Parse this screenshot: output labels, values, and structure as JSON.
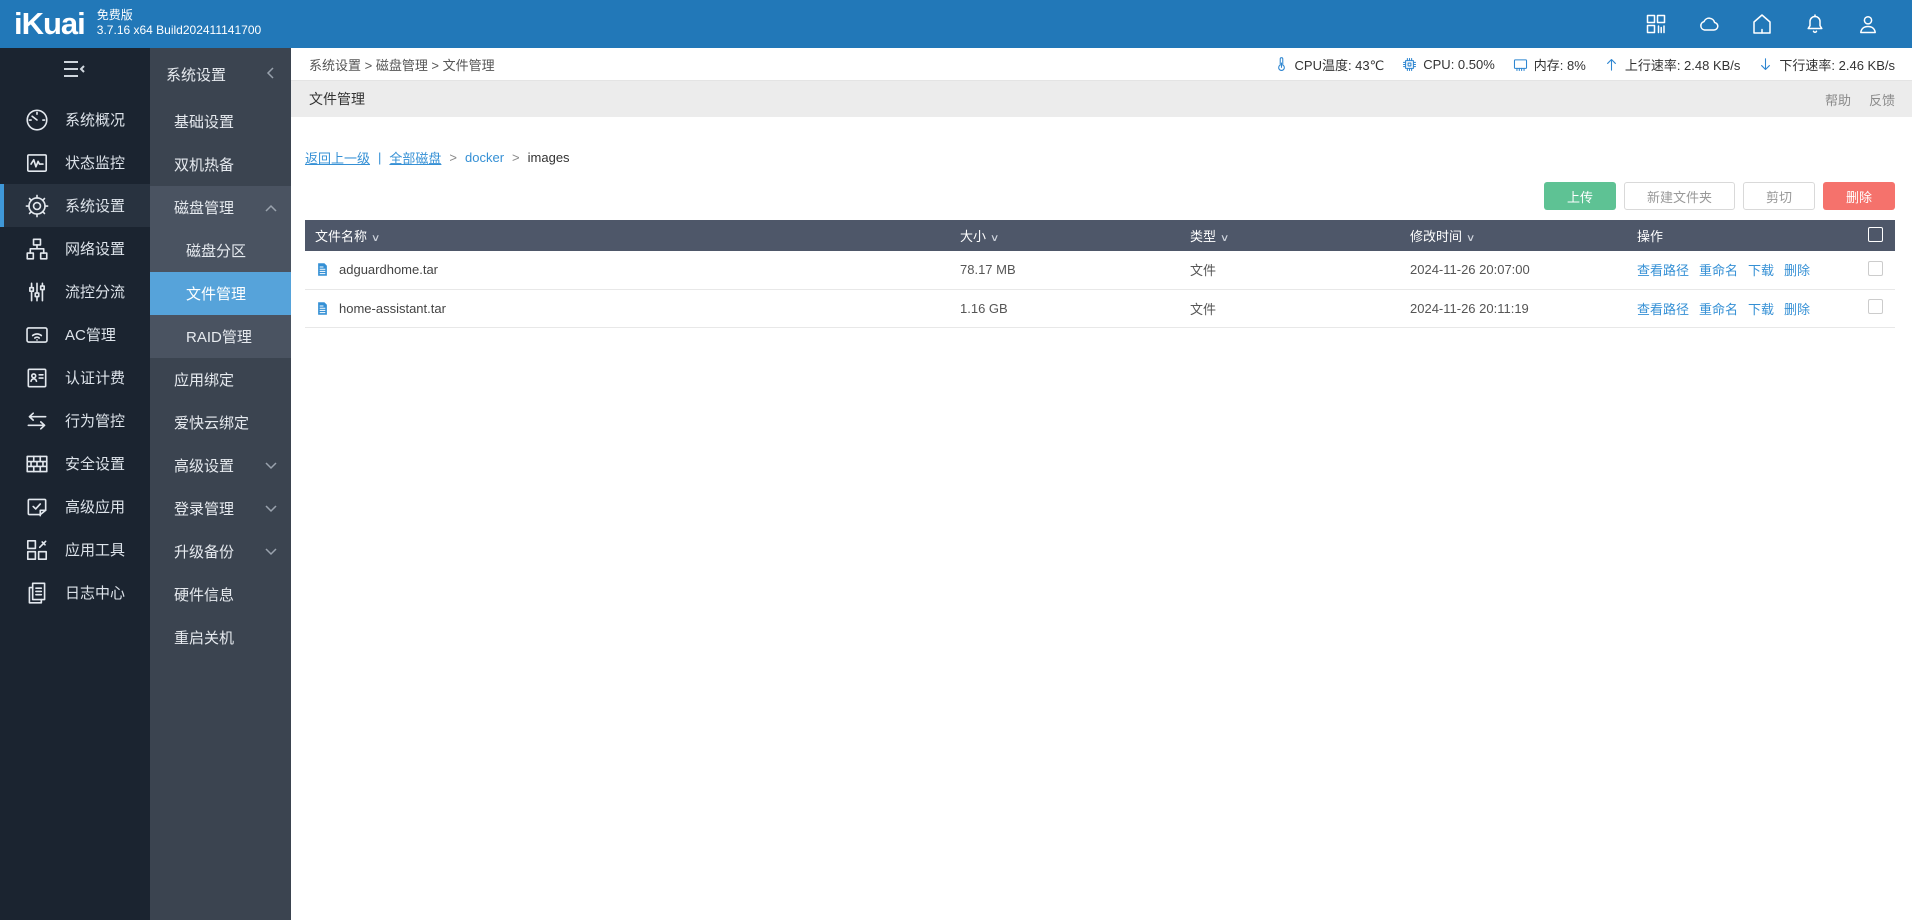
{
  "topbar": {
    "logo": "iKuai",
    "edition": "免费版",
    "build": "3.7.16 x64 Build202411141700",
    "icons": [
      {
        "key": "apps",
        "icon": "apps-grid-icon"
      },
      {
        "key": "cloud",
        "icon": "cloud-icon"
      },
      {
        "key": "home",
        "icon": "home-icon"
      },
      {
        "key": "notifications",
        "icon": "bell-icon"
      },
      {
        "key": "account",
        "icon": "user-icon"
      }
    ]
  },
  "sidebar": {
    "items": [
      {
        "key": "system-overview",
        "label": "系统概况",
        "icon": "gauge-icon",
        "active": false
      },
      {
        "key": "status-monitor",
        "label": "状态监控",
        "icon": "monitor-pulse-icon",
        "active": false
      },
      {
        "key": "system-settings",
        "label": "系统设置",
        "icon": "gear-icon",
        "active": true
      },
      {
        "key": "network-settings",
        "label": "网络设置",
        "icon": "network-icon",
        "active": false
      },
      {
        "key": "flow-control",
        "label": "流控分流",
        "icon": "sliders-icon",
        "active": false
      },
      {
        "key": "ac-management",
        "label": "AC管理",
        "icon": "wifi-icon",
        "active": false
      },
      {
        "key": "auth-billing",
        "label": "认证计费",
        "icon": "id-card-icon",
        "active": false
      },
      {
        "key": "behavior-control",
        "label": "行为管控",
        "icon": "swap-arrows-icon",
        "active": false
      },
      {
        "key": "security-settings",
        "label": "安全设置",
        "icon": "firewall-icon",
        "active": false
      },
      {
        "key": "advanced-apps",
        "label": "高级应用",
        "icon": "app-check-icon",
        "active": false
      },
      {
        "key": "app-tools",
        "label": "应用工具",
        "icon": "tools-grid-icon",
        "active": false
      },
      {
        "key": "log-center",
        "label": "日志中心",
        "icon": "logs-icon",
        "active": false
      }
    ]
  },
  "submenu": {
    "header": "系统设置",
    "items": [
      {
        "key": "basic-settings",
        "label": "基础设置",
        "style": "plain",
        "chevron": ""
      },
      {
        "key": "dual-hot-standby",
        "label": "双机热备",
        "style": "plain",
        "chevron": ""
      },
      {
        "key": "disk-management",
        "label": "磁盘管理",
        "style": "group-head",
        "chevron": "up"
      },
      {
        "key": "disk-partition",
        "label": "磁盘分区",
        "style": "child",
        "chevron": ""
      },
      {
        "key": "file-management",
        "label": "文件管理",
        "style": "child active",
        "chevron": ""
      },
      {
        "key": "raid-management",
        "label": "RAID管理",
        "style": "child",
        "chevron": ""
      },
      {
        "key": "app-binding",
        "label": "应用绑定",
        "style": "plain",
        "chevron": ""
      },
      {
        "key": "ikuai-cloud-binding",
        "label": "爱快云绑定",
        "style": "plain",
        "chevron": ""
      },
      {
        "key": "advanced-settings",
        "label": "高级设置",
        "style": "plain",
        "chevron": "down"
      },
      {
        "key": "login-management",
        "label": "登录管理",
        "style": "plain",
        "chevron": "down"
      },
      {
        "key": "upgrade-backup",
        "label": "升级备份",
        "style": "plain",
        "chevron": "down"
      },
      {
        "key": "hardware-info",
        "label": "硬件信息",
        "style": "plain",
        "chevron": ""
      },
      {
        "key": "reboot-shutdown",
        "label": "重启关机",
        "style": "plain",
        "chevron": ""
      }
    ]
  },
  "breadcrumb": "系统设置 > 磁盘管理 > 文件管理",
  "status": {
    "segments": [
      {
        "icon": "thermometer-icon",
        "text": "CPU温度: 43℃"
      },
      {
        "icon": "cpu-chip-icon",
        "text": "CPU: 0.50%"
      },
      {
        "icon": "memory-icon",
        "text": "内存: 8%"
      },
      {
        "icon": "arrow-up-icon",
        "text": "上行速率: 2.48 KB/s"
      },
      {
        "icon": "arrow-down-icon",
        "text": "下行速率: 2.46 KB/s"
      }
    ]
  },
  "page": {
    "title": "文件管理",
    "help": "帮助",
    "feedback": "反馈"
  },
  "filenav": {
    "back": "返回上一级",
    "separator": "|",
    "crumbs": [
      {
        "label": "全部磁盘",
        "link": true,
        "underline": true
      },
      {
        "label": "docker",
        "link": true,
        "underline": false
      },
      {
        "label": "images",
        "link": false,
        "underline": false
      }
    ]
  },
  "toolbar": {
    "upload": "上传",
    "new_folder": "新建文件夹",
    "cut": "剪切",
    "delete": "删除"
  },
  "table": {
    "headers": {
      "name": "文件名称",
      "size": "大小",
      "type": "类型",
      "mtime": "修改时间",
      "ops": "操作"
    },
    "rows": [
      {
        "name": "adguardhome.tar",
        "size": "78.17 MB",
        "type": "文件",
        "mtime": "2024-11-26 20:07:00",
        "ops": [
          "查看路径",
          "重命名",
          "下载",
          "删除"
        ]
      },
      {
        "name": "home-assistant.tar",
        "size": "1.16 GB",
        "type": "文件",
        "mtime": "2024-11-26 20:11:19",
        "ops": [
          "查看路径",
          "重命名",
          "下载",
          "删除"
        ]
      }
    ]
  }
}
